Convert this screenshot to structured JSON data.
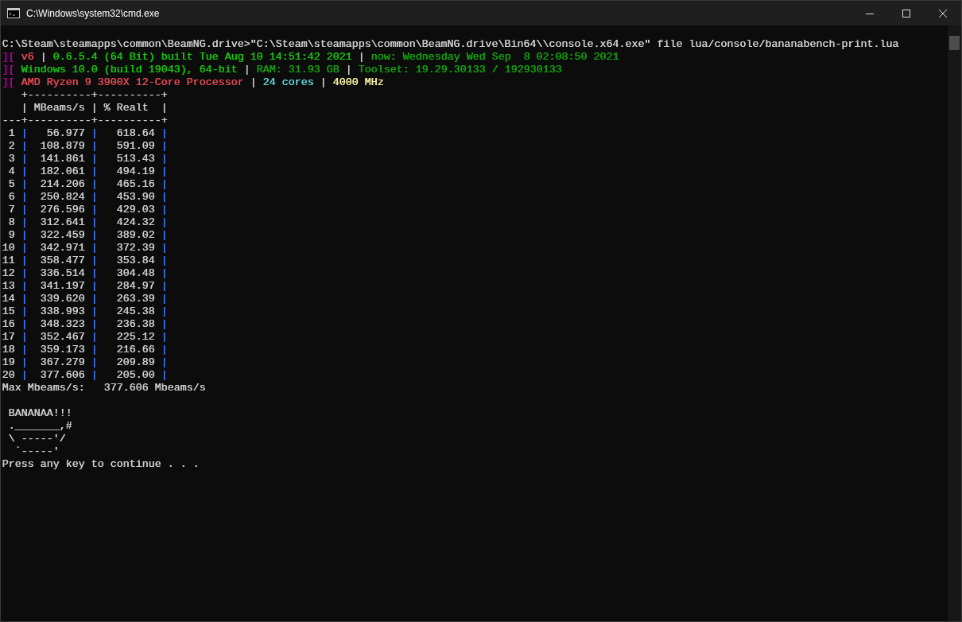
{
  "window": {
    "title": "C:\\Windows\\system32\\cmd.exe"
  },
  "console": {
    "lines": [
      {
        "kind": "blank"
      },
      {
        "kind": "text",
        "segments": [
          {
            "text": "C:\\Steam\\steamapps\\common\\BeamNG.drive>\"C:\\Steam\\steamapps\\common\\BeamNG.drive\\Bin64\\\\console.x64.exe\" file lua/console/bananabench-print.lua",
            "color": "#cccccc"
          }
        ]
      },
      {
        "kind": "text",
        "segments": [
          {
            "text": "][ ",
            "color": "#b4009e"
          },
          {
            "text": "v6",
            "color": "#e74856"
          },
          {
            "text": " | ",
            "color": "#cccccc"
          },
          {
            "text": "0.6.5.4 (64 Bit) built Tue Aug 10 14:51:42 2021",
            "color": "#16c60c"
          },
          {
            "text": " | ",
            "color": "#cccccc"
          },
          {
            "text": "now: Wednesday Wed Sep  8 02:08:50 2021",
            "color": "#13a10e"
          }
        ]
      },
      {
        "kind": "text",
        "segments": [
          {
            "text": "][ ",
            "color": "#b4009e"
          },
          {
            "text": "Windows 10.0 (build 19043), 64-bit",
            "color": "#16c60c"
          },
          {
            "text": " | ",
            "color": "#cccccc"
          },
          {
            "text": "RAM: 31.93 GB",
            "color": "#13a10e"
          },
          {
            "text": " | ",
            "color": "#cccccc"
          },
          {
            "text": "Toolset: 19.29.30133 / 192930133",
            "color": "#13a10e"
          }
        ]
      },
      {
        "kind": "text",
        "segments": [
          {
            "text": "][ ",
            "color": "#b4009e"
          },
          {
            "text": "AMD Ryzen 9 3900X 12-Core Processor",
            "color": "#e74856"
          },
          {
            "text": " | ",
            "color": "#cccccc"
          },
          {
            "text": "24 cores",
            "color": "#61d6d6"
          },
          {
            "text": " | ",
            "color": "#cccccc"
          },
          {
            "text": "4000 MHz",
            "color": "#f9f1a5"
          }
        ]
      },
      {
        "kind": "text",
        "segments": [
          {
            "text": "   +----------+----------+",
            "color": "#cccccc"
          }
        ]
      },
      {
        "kind": "text",
        "segments": [
          {
            "text": "   | MBeams/s | % Realt  |",
            "color": "#cccccc"
          }
        ]
      },
      {
        "kind": "text",
        "segments": [
          {
            "text": "---+----------+----------+",
            "color": "#cccccc"
          }
        ]
      },
      {
        "kind": "text",
        "segments": [
          {
            "text": " 1 ",
            "color": "#cccccc"
          },
          {
            "text": "|",
            "color": "#3b78ff"
          },
          {
            "text": "   56.977 ",
            "color": "#cccccc"
          },
          {
            "text": "|",
            "color": "#3b78ff"
          },
          {
            "text": "   618.64 ",
            "color": "#cccccc"
          },
          {
            "text": "|",
            "color": "#3b78ff"
          }
        ]
      },
      {
        "kind": "text",
        "segments": [
          {
            "text": " 2 ",
            "color": "#cccccc"
          },
          {
            "text": "|",
            "color": "#3b78ff"
          },
          {
            "text": "  108.879 ",
            "color": "#cccccc"
          },
          {
            "text": "|",
            "color": "#3b78ff"
          },
          {
            "text": "   591.09 ",
            "color": "#cccccc"
          },
          {
            "text": "|",
            "color": "#3b78ff"
          }
        ]
      },
      {
        "kind": "text",
        "segments": [
          {
            "text": " 3 ",
            "color": "#cccccc"
          },
          {
            "text": "|",
            "color": "#3b78ff"
          },
          {
            "text": "  141.861 ",
            "color": "#cccccc"
          },
          {
            "text": "|",
            "color": "#3b78ff"
          },
          {
            "text": "   513.43 ",
            "color": "#cccccc"
          },
          {
            "text": "|",
            "color": "#3b78ff"
          }
        ]
      },
      {
        "kind": "text",
        "segments": [
          {
            "text": " 4 ",
            "color": "#cccccc"
          },
          {
            "text": "|",
            "color": "#3b78ff"
          },
          {
            "text": "  182.061 ",
            "color": "#cccccc"
          },
          {
            "text": "|",
            "color": "#3b78ff"
          },
          {
            "text": "   494.19 ",
            "color": "#cccccc"
          },
          {
            "text": "|",
            "color": "#3b78ff"
          }
        ]
      },
      {
        "kind": "text",
        "segments": [
          {
            "text": " 5 ",
            "color": "#cccccc"
          },
          {
            "text": "|",
            "color": "#3b78ff"
          },
          {
            "text": "  214.206 ",
            "color": "#cccccc"
          },
          {
            "text": "|",
            "color": "#3b78ff"
          },
          {
            "text": "   465.16 ",
            "color": "#cccccc"
          },
          {
            "text": "|",
            "color": "#3b78ff"
          }
        ]
      },
      {
        "kind": "text",
        "segments": [
          {
            "text": " 6 ",
            "color": "#cccccc"
          },
          {
            "text": "|",
            "color": "#3b78ff"
          },
          {
            "text": "  250.824 ",
            "color": "#cccccc"
          },
          {
            "text": "|",
            "color": "#3b78ff"
          },
          {
            "text": "   453.90 ",
            "color": "#cccccc"
          },
          {
            "text": "|",
            "color": "#3b78ff"
          }
        ]
      },
      {
        "kind": "text",
        "segments": [
          {
            "text": " 7 ",
            "color": "#cccccc"
          },
          {
            "text": "|",
            "color": "#3b78ff"
          },
          {
            "text": "  276.596 ",
            "color": "#cccccc"
          },
          {
            "text": "|",
            "color": "#3b78ff"
          },
          {
            "text": "   429.03 ",
            "color": "#cccccc"
          },
          {
            "text": "|",
            "color": "#3b78ff"
          }
        ]
      },
      {
        "kind": "text",
        "segments": [
          {
            "text": " 8 ",
            "color": "#cccccc"
          },
          {
            "text": "|",
            "color": "#3b78ff"
          },
          {
            "text": "  312.641 ",
            "color": "#cccccc"
          },
          {
            "text": "|",
            "color": "#3b78ff"
          },
          {
            "text": "   424.32 ",
            "color": "#cccccc"
          },
          {
            "text": "|",
            "color": "#3b78ff"
          }
        ]
      },
      {
        "kind": "text",
        "segments": [
          {
            "text": " 9 ",
            "color": "#cccccc"
          },
          {
            "text": "|",
            "color": "#3b78ff"
          },
          {
            "text": "  322.459 ",
            "color": "#cccccc"
          },
          {
            "text": "|",
            "color": "#3b78ff"
          },
          {
            "text": "   389.02 ",
            "color": "#cccccc"
          },
          {
            "text": "|",
            "color": "#3b78ff"
          }
        ]
      },
      {
        "kind": "text",
        "segments": [
          {
            "text": "10 ",
            "color": "#cccccc"
          },
          {
            "text": "|",
            "color": "#3b78ff"
          },
          {
            "text": "  342.971 ",
            "color": "#cccccc"
          },
          {
            "text": "|",
            "color": "#3b78ff"
          },
          {
            "text": "   372.39 ",
            "color": "#cccccc"
          },
          {
            "text": "|",
            "color": "#3b78ff"
          }
        ]
      },
      {
        "kind": "text",
        "segments": [
          {
            "text": "11 ",
            "color": "#cccccc"
          },
          {
            "text": "|",
            "color": "#3b78ff"
          },
          {
            "text": "  358.477 ",
            "color": "#cccccc"
          },
          {
            "text": "|",
            "color": "#3b78ff"
          },
          {
            "text": "   353.84 ",
            "color": "#cccccc"
          },
          {
            "text": "|",
            "color": "#3b78ff"
          }
        ]
      },
      {
        "kind": "text",
        "segments": [
          {
            "text": "12 ",
            "color": "#cccccc"
          },
          {
            "text": "|",
            "color": "#3b78ff"
          },
          {
            "text": "  336.514 ",
            "color": "#cccccc"
          },
          {
            "text": "|",
            "color": "#3b78ff"
          },
          {
            "text": "   304.48 ",
            "color": "#cccccc"
          },
          {
            "text": "|",
            "color": "#3b78ff"
          }
        ]
      },
      {
        "kind": "text",
        "segments": [
          {
            "text": "13 ",
            "color": "#cccccc"
          },
          {
            "text": "|",
            "color": "#3b78ff"
          },
          {
            "text": "  341.197 ",
            "color": "#cccccc"
          },
          {
            "text": "|",
            "color": "#3b78ff"
          },
          {
            "text": "   284.97 ",
            "color": "#cccccc"
          },
          {
            "text": "|",
            "color": "#3b78ff"
          }
        ]
      },
      {
        "kind": "text",
        "segments": [
          {
            "text": "14 ",
            "color": "#cccccc"
          },
          {
            "text": "|",
            "color": "#3b78ff"
          },
          {
            "text": "  339.620 ",
            "color": "#cccccc"
          },
          {
            "text": "|",
            "color": "#3b78ff"
          },
          {
            "text": "   263.39 ",
            "color": "#cccccc"
          },
          {
            "text": "|",
            "color": "#3b78ff"
          }
        ]
      },
      {
        "kind": "text",
        "segments": [
          {
            "text": "15 ",
            "color": "#cccccc"
          },
          {
            "text": "|",
            "color": "#3b78ff"
          },
          {
            "text": "  338.993 ",
            "color": "#cccccc"
          },
          {
            "text": "|",
            "color": "#3b78ff"
          },
          {
            "text": "   245.38 ",
            "color": "#cccccc"
          },
          {
            "text": "|",
            "color": "#3b78ff"
          }
        ]
      },
      {
        "kind": "text",
        "segments": [
          {
            "text": "16 ",
            "color": "#cccccc"
          },
          {
            "text": "|",
            "color": "#3b78ff"
          },
          {
            "text": "  348.323 ",
            "color": "#cccccc"
          },
          {
            "text": "|",
            "color": "#3b78ff"
          },
          {
            "text": "   236.38 ",
            "color": "#cccccc"
          },
          {
            "text": "|",
            "color": "#3b78ff"
          }
        ]
      },
      {
        "kind": "text",
        "segments": [
          {
            "text": "17 ",
            "color": "#cccccc"
          },
          {
            "text": "|",
            "color": "#3b78ff"
          },
          {
            "text": "  352.467 ",
            "color": "#cccccc"
          },
          {
            "text": "|",
            "color": "#3b78ff"
          },
          {
            "text": "   225.12 ",
            "color": "#cccccc"
          },
          {
            "text": "|",
            "color": "#3b78ff"
          }
        ]
      },
      {
        "kind": "text",
        "segments": [
          {
            "text": "18 ",
            "color": "#cccccc"
          },
          {
            "text": "|",
            "color": "#3b78ff"
          },
          {
            "text": "  359.173 ",
            "color": "#cccccc"
          },
          {
            "text": "|",
            "color": "#3b78ff"
          },
          {
            "text": "   216.66 ",
            "color": "#cccccc"
          },
          {
            "text": "|",
            "color": "#3b78ff"
          }
        ]
      },
      {
        "kind": "text",
        "segments": [
          {
            "text": "19 ",
            "color": "#cccccc"
          },
          {
            "text": "|",
            "color": "#3b78ff"
          },
          {
            "text": "  367.279 ",
            "color": "#cccccc"
          },
          {
            "text": "|",
            "color": "#3b78ff"
          },
          {
            "text": "   209.89 ",
            "color": "#cccccc"
          },
          {
            "text": "|",
            "color": "#3b78ff"
          }
        ]
      },
      {
        "kind": "text",
        "segments": [
          {
            "text": "20 ",
            "color": "#cccccc"
          },
          {
            "text": "|",
            "color": "#3b78ff"
          },
          {
            "text": "  377.606 ",
            "color": "#cccccc"
          },
          {
            "text": "|",
            "color": "#3b78ff"
          },
          {
            "text": "   205.00 ",
            "color": "#cccccc"
          },
          {
            "text": "|",
            "color": "#3b78ff"
          }
        ]
      },
      {
        "kind": "text",
        "segments": [
          {
            "text": "Max Mbeams/s:   377.606 Mbeams/s",
            "color": "#cccccc"
          }
        ]
      },
      {
        "kind": "blank"
      },
      {
        "kind": "text",
        "segments": [
          {
            "text": " BANANAA!!!",
            "color": "#cccccc"
          }
        ]
      },
      {
        "kind": "text",
        "segments": [
          {
            "text": " ._______,#",
            "color": "#cccccc"
          }
        ]
      },
      {
        "kind": "text",
        "segments": [
          {
            "text": " \\ -----'/",
            "color": "#cccccc"
          }
        ]
      },
      {
        "kind": "text",
        "segments": [
          {
            "text": "  `-----'",
            "color": "#cccccc"
          }
        ]
      },
      {
        "kind": "text",
        "segments": [
          {
            "text": "Press any key to continue . . .",
            "color": "#cccccc"
          }
        ]
      }
    ]
  }
}
